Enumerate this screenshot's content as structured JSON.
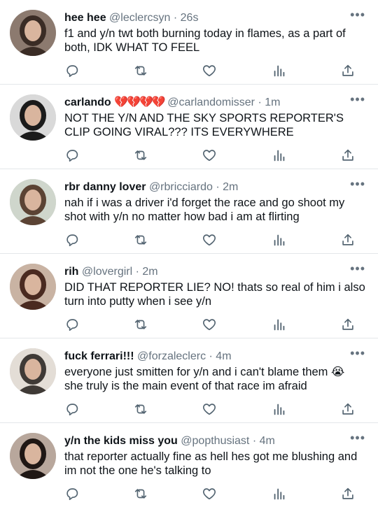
{
  "tweets": [
    {
      "name": "hee hee",
      "emojis": "",
      "handle": "@leclercsyn",
      "time": "· 26s",
      "text": "f1 and y/n twt both burning today in flames, as a part of both, IDK WHAT TO FEEL",
      "avatar_colors": [
        "#8c7a6f",
        "#3a2c25"
      ]
    },
    {
      "name": "carlando",
      "emojis": "💔💔💔💔",
      "handle": "@carlandomisser",
      "time": "· 1m",
      "text": "NOT THE Y/N AND THE SKY SPORTS REPORTER'S CLIP GOING VIRAL??? ITS EVERYWHERE",
      "avatar_colors": [
        "#d9d9d9",
        "#1b1b1b"
      ]
    },
    {
      "name": "rbr danny lover",
      "emojis": "",
      "handle": "@rbricciardo",
      "time": "· 2m",
      "text": "nah if i was a driver i'd forget the race and go shoot my shot with y/n no matter how bad i am at flirting",
      "avatar_colors": [
        "#cfd6cc",
        "#5b4334"
      ]
    },
    {
      "name": "rih",
      "emojis": "",
      "handle": "@lovergirl",
      "time": "· 2m",
      "text": "DID THAT REPORTER LIE? NO! thats so real of him i also turn into putty when i see y/n",
      "avatar_colors": [
        "#c9b3a3",
        "#4a2a20"
      ]
    },
    {
      "name": "fuck ferrari!!!",
      "emojis": "",
      "handle": "@forzaleclerc",
      "time": "· 4m",
      "text": "everyone just smitten for y/n and i can't blame them 😭 she truly is the main event of that race im afraid",
      "avatar_colors": [
        "#e3ddd6",
        "#3f3a36"
      ]
    },
    {
      "name": "y/n the kids miss you",
      "emojis": "",
      "handle": "@popthusiast",
      "time": "· 4m",
      "text": "that reporter actually fine as hell hes got me blushing and im not the one he's talking to",
      "avatar_colors": [
        "#b8a79c",
        "#1f1714"
      ]
    }
  ],
  "icons": {
    "reply": "reply-icon",
    "retweet": "retweet-icon",
    "like": "heart-icon",
    "views": "analytics-icon",
    "share": "share-icon",
    "more": "more-icon"
  },
  "more_glyph": "•••",
  "colors": {
    "icon": "#536471",
    "handle": "#66737f",
    "divider": "#e4e7ea"
  }
}
